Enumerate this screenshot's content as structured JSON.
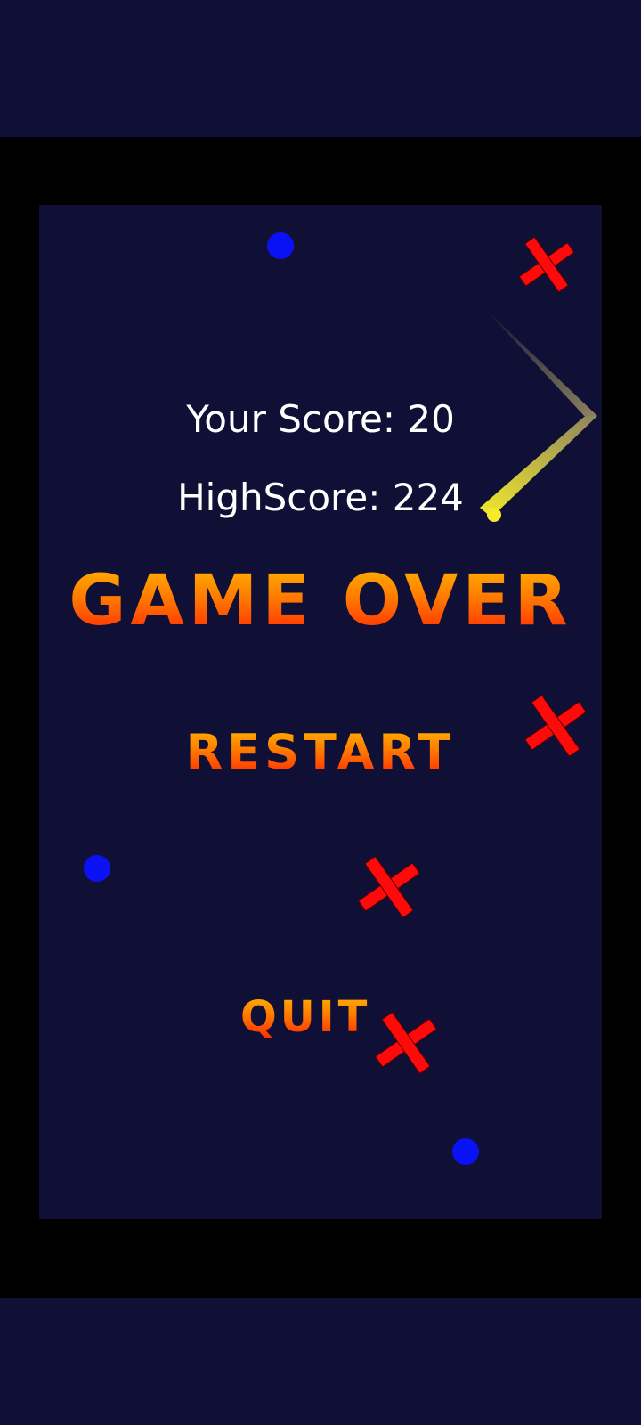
{
  "hud": {
    "your_score_label": "Your Score: 20",
    "high_score_label": "HighScore: 224"
  },
  "game_over": {
    "title": "GAME OVER",
    "restart_label": "RESTART",
    "quit_label": "QUIT"
  },
  "colors": {
    "background": "#100f36",
    "frame": "#000000",
    "dot": "#0a12f5",
    "cross": "#ff0a0a",
    "trail": "#f3ea2a",
    "score_text": "#ffffff",
    "title_gradient_top": "#ffb000",
    "title_gradient_bottom": "#ff2a00"
  },
  "icons": {
    "dot": "blue-dot-icon",
    "cross": "red-cross-icon",
    "trail": "yellow-trail-icon"
  }
}
